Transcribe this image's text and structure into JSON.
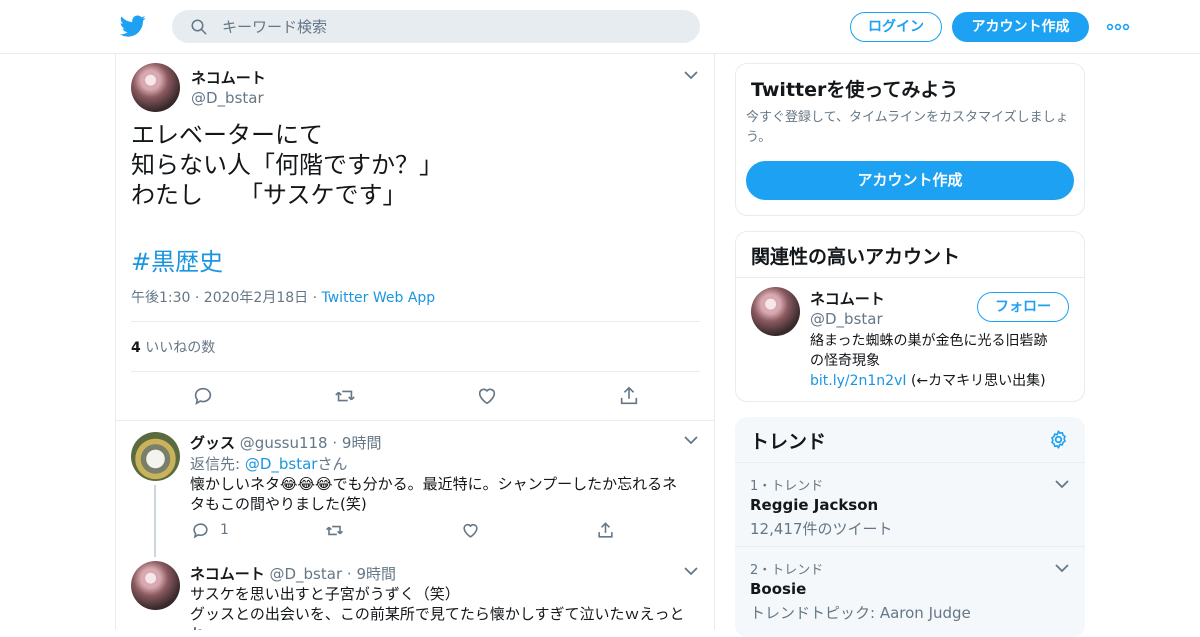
{
  "header": {
    "search_placeholder": "キーワード検索",
    "login_label": "ログイン",
    "signup_label": "アカウント作成"
  },
  "tweet": {
    "name": "ネコムート",
    "handle": "@D_bstar",
    "lines": [
      "エレベーターにて",
      "知らない人「何階ですか？」",
      "わたし　　「サスケです」"
    ],
    "hashtag": "#黒歴史",
    "timestamp": "午後1:30 · 2020年2月18日 · ",
    "source": "Twitter Web App",
    "like_count": "4",
    "like_label": " いいねの数"
  },
  "replies": [
    {
      "name": "グッス",
      "handle": "@gussu118",
      "time": "· 9時間",
      "reply_prefix": "返信先: ",
      "reply_to": "@D_bstar",
      "reply_suffix": "さん",
      "text_line1": "懐かしいネタ😂😂😂でも分かる。最近特に。シャンプーしたか忘れるネ",
      "text_line2": "タもこの間やりました(笑)",
      "reply_count": "1"
    },
    {
      "name": "ネコムート",
      "handle": "@D_bstar",
      "time": "· 9時間",
      "text_line1": "サスケを思い出すと子宮がうずく（笑）",
      "text_line2": "グッスとの出会いを、この前某所で見てたら懐かしすぎて泣いたｗえっと",
      "text_line3": "ね"
    }
  ],
  "sidebar": {
    "try_title": "Twitterを使ってみよう",
    "try_text": "今すぐ登録して、タイムラインをカスタマイズしましょう。",
    "try_button": "アカウント作成",
    "related_title": "関連性の高いアカウント",
    "account": {
      "name": "ネコムート",
      "handle": "@D_bstar",
      "follow_label": "フォロー",
      "bio_line1": "絡まった蜘蛛の巣が金色に光る旧砦跡",
      "bio_line2": "の怪奇現象",
      "bio_link": "bit.ly/2n1n2vI",
      "bio_after": " (←カマキリ思い出集)"
    },
    "trends_title": "トレンド",
    "trends": [
      {
        "rank": "1・トレンド",
        "name": "Reggie Jackson",
        "meta": "12,417件のツイート"
      },
      {
        "rank": "2・トレンド",
        "name": "Boosie",
        "meta": "トレンドトピック: Aaron Judge"
      }
    ]
  },
  "colors": {
    "accent": "#1da1f2",
    "link": "#1b95e0",
    "grey": "#657786",
    "border": "#e6ecf0"
  }
}
